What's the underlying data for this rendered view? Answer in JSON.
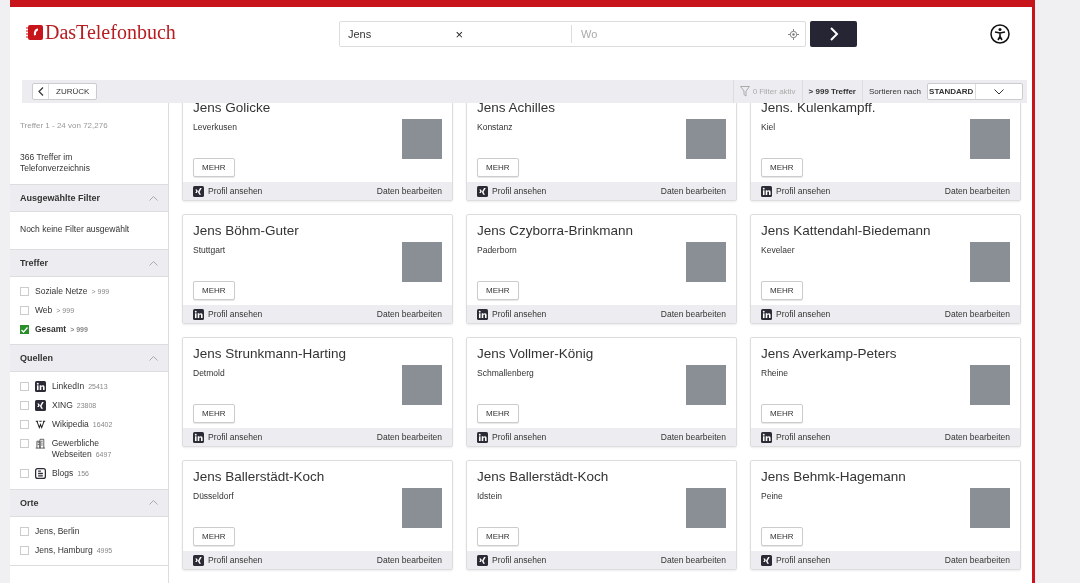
{
  "header": {
    "logo": "DasTelefonbuch",
    "search": {
      "value": "Jens",
      "clear": "×"
    },
    "location": {
      "placeholder": "Wo"
    }
  },
  "toolbar": {
    "back": "ZURÜCK",
    "filter_count": "0",
    "filter": "Filter aktiv",
    "hits": "> 999 Treffer",
    "sort_label": "Sortieren nach",
    "sort_value": "STANDARD"
  },
  "sidebar": {
    "range": "Treffer 1 - 24 von 72,276",
    "directory": "366 Treffer im Telefonverzeichnis",
    "sections": [
      {
        "title": "Ausgewählte Filter",
        "expanded": true,
        "text": "Noch keine Filter ausgewählt"
      },
      {
        "title": "Treffer",
        "expanded": true,
        "items": [
          {
            "label": "Soziale Netze",
            "count": "> 999",
            "checked": false
          },
          {
            "label": "Web",
            "count": "> 999",
            "checked": false
          },
          {
            "label": "Gesamt",
            "count": "> 999",
            "checked": true
          }
        ]
      },
      {
        "title": "Quellen",
        "expanded": true,
        "items": [
          {
            "label": "LinkedIn",
            "count": "25413",
            "checked": false,
            "kind": "linkedin"
          },
          {
            "label": "XING",
            "count": "23808",
            "checked": false,
            "kind": "xing"
          },
          {
            "label": "Wikipedia",
            "count": "16402",
            "checked": false,
            "kind": "wikipedia"
          },
          {
            "label": "Gewerbliche Webseiten",
            "count": "6497",
            "checked": false,
            "kind": "building"
          },
          {
            "label": "Blogs",
            "count": "156",
            "checked": false,
            "kind": "blog"
          }
        ]
      },
      {
        "title": "Orte",
        "expanded": true,
        "items": [
          {
            "label": "Jens, Berlin",
            "checked": false
          },
          {
            "label": "Jens, Hamburg",
            "count": "4995",
            "checked": false
          }
        ]
      }
    ]
  },
  "cards": [
    {
      "name": "Jens Golicke",
      "city": "Leverkusen",
      "kind": "xing",
      "more": "MEHR",
      "profile": "Profil ansehen",
      "edit": "Daten bearbeiten"
    },
    {
      "name": "Jens Achilles",
      "city": "Konstanz",
      "kind": "xing",
      "more": "MEHR",
      "profile": "Profil ansehen",
      "edit": "Daten bearbeiten"
    },
    {
      "name": "Jens. Kulenkampff.",
      "city": "Kiel",
      "kind": "linkedin",
      "more": "MEHR",
      "profile": "Profil ansehen",
      "edit": "Daten bearbeiten"
    },
    {
      "name": "Jens Böhm-Guter",
      "city": "Stuttgart",
      "kind": "linkedin",
      "more": "MEHR",
      "profile": "Profil ansehen",
      "edit": "Daten bearbeiten"
    },
    {
      "name": "Jens Czyborra-Brinkmann",
      "city": "Paderborn",
      "kind": "linkedin",
      "more": "MEHR",
      "profile": "Profil ansehen",
      "edit": "Daten bearbeiten"
    },
    {
      "name": "Jens Kattendahl-Biedemann",
      "city": "Kevelaer",
      "kind": "linkedin",
      "more": "MEHR",
      "profile": "Profil ansehen",
      "edit": "Daten bearbeiten"
    },
    {
      "name": "Jens Strunkmann-Harting",
      "city": "Detmold",
      "kind": "linkedin",
      "more": "MEHR",
      "profile": "Profil ansehen",
      "edit": "Daten bearbeiten"
    },
    {
      "name": "Jens Vollmer-König",
      "city": "Schmallenberg",
      "kind": "linkedin",
      "more": "MEHR",
      "profile": "Profil ansehen",
      "edit": "Daten bearbeiten"
    },
    {
      "name": "Jens Averkamp-Peters",
      "city": "Rheine",
      "kind": "linkedin",
      "more": "MEHR",
      "profile": "Profil ansehen",
      "edit": "Daten bearbeiten"
    },
    {
      "name": "Jens Ballerstädt-Koch",
      "city": "Düsseldorf",
      "kind": "xing",
      "more": "MEHR",
      "profile": "Profil ansehen",
      "edit": "Daten bearbeiten"
    },
    {
      "name": "Jens Ballerstädt-Koch",
      "city": "Idstein",
      "kind": "xing",
      "more": "MEHR",
      "profile": "Profil ansehen",
      "edit": "Daten bearbeiten"
    },
    {
      "name": "Jens Behmk-Hagemann",
      "city": "Peine",
      "kind": "xing",
      "more": "MEHR",
      "profile": "Profil ansehen",
      "edit": "Daten bearbeiten"
    }
  ]
}
